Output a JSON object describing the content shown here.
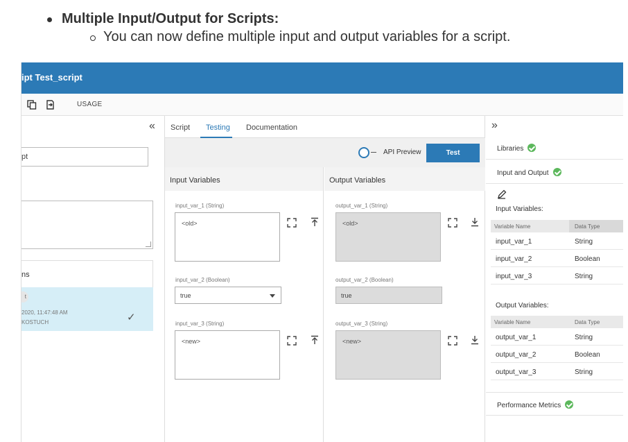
{
  "doc": {
    "bullet_title": "Multiple Input/Output for Scripts:",
    "bullet_sub": "You can now define multiple input and output variables for a script."
  },
  "app": {
    "title": "ipt Test_script",
    "toolbar": {
      "usage_label": "USAGE"
    },
    "left": {
      "input_value": "pt",
      "list_header": "ns",
      "selected_item": {
        "chip": "t",
        "date": "2020, 11:47:48 AM",
        "user": "KOSTUCH"
      }
    },
    "tabs": [
      {
        "label": "Script"
      },
      {
        "label": "Testing"
      },
      {
        "label": "Documentation"
      }
    ],
    "api_preview_label": "API Preview",
    "test_button_label": "Test",
    "input_header": "Input Variables",
    "output_header": "Output Variables",
    "inputs": [
      {
        "label": "input_var_1 (String)",
        "value": "<old>"
      },
      {
        "label": "input_var_2 (Boolean)",
        "value": "true"
      },
      {
        "label": "input_var_3 (String)",
        "value": "<new>"
      }
    ],
    "outputs": [
      {
        "label": "output_var_1 (String)",
        "value": "<old>"
      },
      {
        "label": "output_var_2 (Boolean)",
        "value": "true"
      },
      {
        "label": "output_var_3 (String)",
        "value": "<new>"
      }
    ],
    "right": {
      "libraries_label": "Libraries",
      "io_label": "Input and Output",
      "input_vars_title": "Input Variables:",
      "output_vars_title": "Output Variables:",
      "col_name": "Variable Name",
      "col_type": "Data Type",
      "input_rows": [
        {
          "name": "input_var_1",
          "type": "String"
        },
        {
          "name": "input_var_2",
          "type": "Boolean"
        },
        {
          "name": "input_var_3",
          "type": "String"
        }
      ],
      "output_rows": [
        {
          "name": "output_var_1",
          "type": "String"
        },
        {
          "name": "output_var_2",
          "type": "Boolean"
        },
        {
          "name": "output_var_3",
          "type": "String"
        }
      ],
      "performance_label": "Performance Metrics"
    }
  },
  "colors": {
    "accent": "#2c7ab6",
    "success": "#5cb85c",
    "selected_row": "#d6eef7"
  }
}
